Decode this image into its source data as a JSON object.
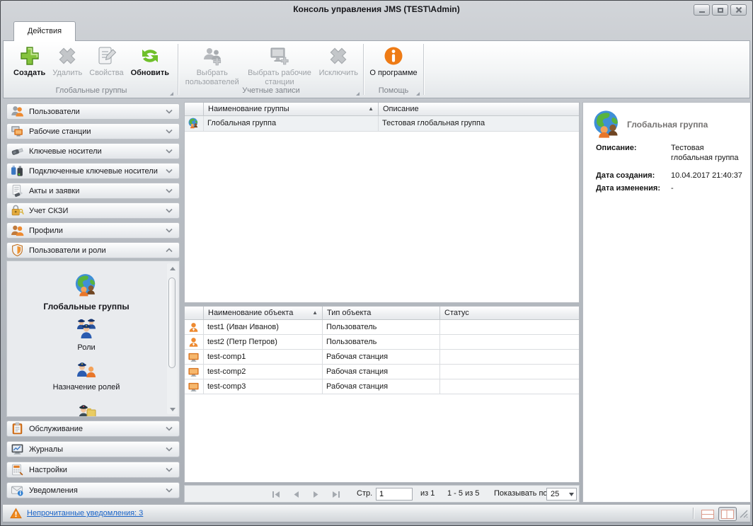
{
  "window": {
    "title": "Консоль управления JMS (TEST\\Admin)"
  },
  "icons": {
    "sort_asc": "▲"
  },
  "ribbon": {
    "tab": "Действия",
    "groups": [
      {
        "label": "Глобальные группы",
        "buttons": [
          {
            "label": "Создать",
            "enabled": true
          },
          {
            "label": "Удалить",
            "enabled": false
          },
          {
            "label": "Свойства",
            "enabled": false
          },
          {
            "label": "Обновить",
            "enabled": true
          }
        ]
      },
      {
        "label": "Учетные записи",
        "buttons": [
          {
            "label": "Выбрать пользователей",
            "enabled": false
          },
          {
            "label": "Выбрать рабочие станции",
            "enabled": false
          },
          {
            "label": "Исключить",
            "enabled": false
          }
        ]
      },
      {
        "label": "Помощь",
        "buttons": [
          {
            "label": "О программе",
            "enabled": true
          }
        ]
      }
    ]
  },
  "sidebar": {
    "sections": [
      {
        "label": "Пользователи"
      },
      {
        "label": "Рабочие станции"
      },
      {
        "label": "Ключевые носители"
      },
      {
        "label": "Подключенные ключевые носители"
      },
      {
        "label": "Акты и заявки"
      },
      {
        "label": "Учет СКЗИ"
      },
      {
        "label": "Профили"
      },
      {
        "label": "Пользователи и роли",
        "expanded": true
      },
      {
        "label": "Обслуживание"
      },
      {
        "label": "Журналы"
      },
      {
        "label": "Настройки"
      },
      {
        "label": "Уведомления"
      }
    ],
    "nav_items": [
      {
        "label": "Глобальные группы",
        "selected": true
      },
      {
        "label": "Роли",
        "selected": false
      },
      {
        "label": "Назначение ролей",
        "selected": false
      }
    ]
  },
  "groups_table": {
    "columns": {
      "name": "Наименование группы",
      "description": "Описание"
    },
    "rows": [
      {
        "name": "Глобальная группа",
        "description": "Тестовая глобальная группа"
      }
    ]
  },
  "members_table": {
    "columns": {
      "name": "Наименование объекта",
      "type": "Тип объекта",
      "status": "Статус"
    },
    "rows": [
      {
        "name": "test1 (Иван Иванов)",
        "type": "Пользователь",
        "status": ""
      },
      {
        "name": "test2 (Петр Петров)",
        "type": "Пользователь",
        "status": ""
      },
      {
        "name": "test-comp1",
        "type": "Рабочая станция",
        "status": ""
      },
      {
        "name": "test-comp2",
        "type": "Рабочая станция",
        "status": ""
      },
      {
        "name": "test-comp3",
        "type": "Рабочая станция",
        "status": ""
      }
    ]
  },
  "pagination": {
    "page_label": "Стр.",
    "page_value": "1",
    "pages_total": "из 1",
    "range": "1 - 5 из 5",
    "page_size_label": "Показывать по",
    "page_size": "25"
  },
  "details": {
    "title": "Глобальная группа",
    "fields": [
      {
        "label": "Описание:",
        "value": "Тестовая глобальная группа"
      },
      {
        "label": "Дата создания:",
        "value": "10.04.2017 21:40:37"
      },
      {
        "label": "Дата изменения:",
        "value": "-"
      }
    ]
  },
  "statusbar": {
    "notifications_link": "Непрочитанные уведомления: 3"
  },
  "colors": {
    "accent_green": "#7cc142",
    "accent_orange": "#ef7d17",
    "link_blue": "#1a64c8"
  }
}
